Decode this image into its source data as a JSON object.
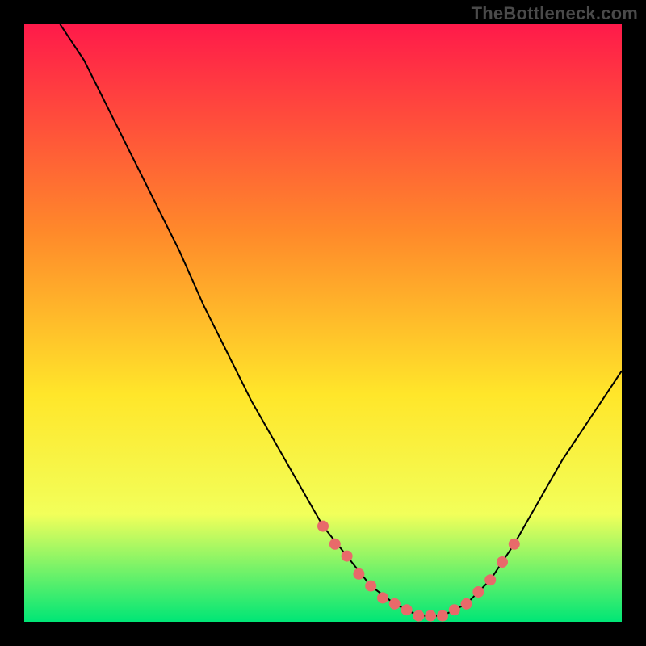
{
  "watermark": "TheBottleneck.com",
  "chart_data": {
    "type": "line",
    "title": "",
    "xlabel": "",
    "ylabel": "",
    "xlim": [
      0,
      100
    ],
    "ylim": [
      0,
      100
    ],
    "grid": false,
    "legend": false,
    "background_gradient": {
      "top": "#ff1a4a",
      "mid1": "#ff8a2a",
      "mid2": "#ffe62a",
      "mid3": "#f2ff5a",
      "bottom": "#00e676"
    },
    "series": [
      {
        "name": "bottleneck-curve",
        "color": "#000000",
        "x": [
          6,
          10,
          14,
          18,
          22,
          26,
          30,
          34,
          38,
          42,
          46,
          50,
          54,
          58,
          62,
          66,
          70,
          74,
          78,
          82,
          86,
          90,
          94,
          98,
          100
        ],
        "values": [
          100,
          94,
          86,
          78,
          70,
          62,
          53,
          45,
          37,
          30,
          23,
          16,
          11,
          6,
          3,
          1,
          1,
          3,
          7,
          13,
          20,
          27,
          33,
          39,
          42
        ]
      }
    ],
    "marker_points": {
      "name": "highlight-dots",
      "color": "#e86a6a",
      "x": [
        50,
        52,
        54,
        56,
        58,
        60,
        62,
        64,
        66,
        68,
        70,
        72,
        74,
        76,
        78,
        80,
        82
      ],
      "values": [
        16,
        13,
        11,
        8,
        6,
        4,
        3,
        2,
        1,
        1,
        1,
        2,
        3,
        5,
        7,
        10,
        13
      ]
    }
  }
}
